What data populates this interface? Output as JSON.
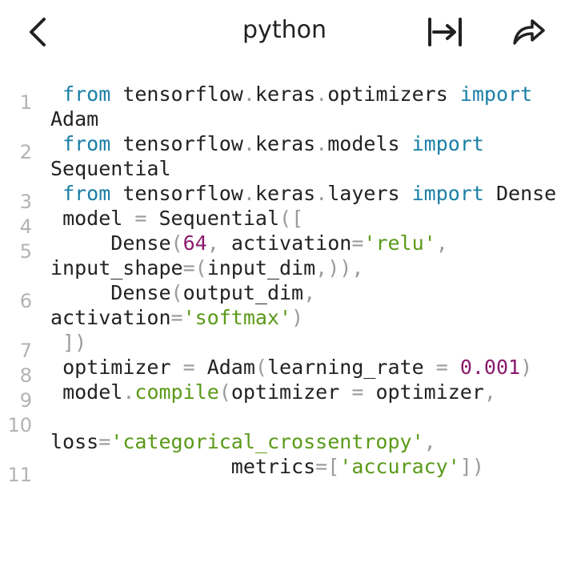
{
  "header": {
    "title": "python",
    "icons": {
      "back": "chevron-left-icon",
      "wrap": "wrap-text-icon",
      "share": "share-icon"
    }
  },
  "code": {
    "lines": [
      {
        "no": "1",
        "tokens": [
          [
            " ",
            ""
          ],
          [
            "from",
            "kw"
          ],
          [
            " tensorflow",
            ""
          ],
          [
            ".",
            "pun"
          ],
          [
            "keras",
            ""
          ],
          [
            ".",
            "pun"
          ],
          [
            "optimizers ",
            ""
          ],
          [
            "import",
            "kw"
          ],
          [
            " Adam",
            ""
          ]
        ]
      },
      {
        "no": "2",
        "tokens": [
          [
            " ",
            ""
          ],
          [
            "from",
            "kw"
          ],
          [
            " tensorflow",
            ""
          ],
          [
            ".",
            "pun"
          ],
          [
            "keras",
            ""
          ],
          [
            ".",
            "pun"
          ],
          [
            "models ",
            ""
          ],
          [
            "import",
            "kw"
          ],
          [
            " Sequential",
            ""
          ]
        ]
      },
      {
        "no": "3",
        "tokens": [
          [
            " ",
            ""
          ],
          [
            "from",
            "kw"
          ],
          [
            " tensorflow",
            ""
          ],
          [
            ".",
            "pun"
          ],
          [
            "keras",
            ""
          ],
          [
            ".",
            "pun"
          ],
          [
            "layers ",
            ""
          ],
          [
            "import",
            "kw"
          ],
          [
            " Dense",
            ""
          ]
        ]
      },
      {
        "no": "4",
        "tokens": [
          [
            " model ",
            ""
          ],
          [
            "=",
            "pun"
          ],
          [
            " Sequential",
            ""
          ],
          [
            "([",
            "pun"
          ]
        ]
      },
      {
        "no": "5",
        "tokens": [
          [
            "     Dense",
            ""
          ],
          [
            "(",
            "pun"
          ],
          [
            "64",
            "num"
          ],
          [
            ",",
            "pun"
          ],
          [
            " activation",
            ""
          ],
          [
            "=",
            "pun"
          ],
          [
            "'relu'",
            "str"
          ],
          [
            ",",
            "pun"
          ],
          [
            " input_shape",
            ""
          ],
          [
            "=",
            "pun"
          ],
          [
            "(",
            "pun"
          ],
          [
            "input_dim",
            ""
          ],
          [
            ",))",
            "pun"
          ],
          [
            ",",
            "pun"
          ]
        ]
      },
      {
        "no": "6",
        "tokens": [
          [
            "     Dense",
            ""
          ],
          [
            "(",
            "pun"
          ],
          [
            "output_dim",
            ""
          ],
          [
            ",",
            "pun"
          ],
          [
            " activation",
            ""
          ],
          [
            "=",
            "pun"
          ],
          [
            "'softmax'",
            "str"
          ],
          [
            ")",
            "pun"
          ]
        ]
      },
      {
        "no": "7",
        "tokens": [
          [
            " ])",
            "pun"
          ]
        ]
      },
      {
        "no": "8",
        "tokens": [
          [
            " optimizer ",
            ""
          ],
          [
            "=",
            "pun"
          ],
          [
            " Adam",
            ""
          ],
          [
            "(",
            "pun"
          ],
          [
            "learning_rate ",
            ""
          ],
          [
            "=",
            "pun"
          ],
          [
            " ",
            ""
          ],
          [
            "0.001",
            "num"
          ],
          [
            ")",
            "pun"
          ]
        ]
      },
      {
        "no": "9",
        "tokens": [
          [
            " model",
            ""
          ],
          [
            ".",
            "pun"
          ],
          [
            "compile",
            "fn"
          ],
          [
            "(",
            "pun"
          ],
          [
            "optimizer ",
            ""
          ],
          [
            "=",
            "pun"
          ],
          [
            " optimizer",
            ""
          ],
          [
            ",",
            "pun"
          ]
        ]
      },
      {
        "no": "10",
        "tokens": [
          [
            "                 loss",
            ""
          ],
          [
            "=",
            "pun"
          ],
          [
            "'categorical_crossentropy'",
            "str"
          ],
          [
            ",",
            "pun"
          ]
        ]
      },
      {
        "no": "11",
        "tokens": [
          [
            "               metrics",
            ""
          ],
          [
            "=",
            "pun"
          ],
          [
            "[",
            "pun"
          ],
          [
            "'accuracy'",
            "str"
          ],
          [
            "])",
            "pun"
          ]
        ]
      }
    ]
  }
}
